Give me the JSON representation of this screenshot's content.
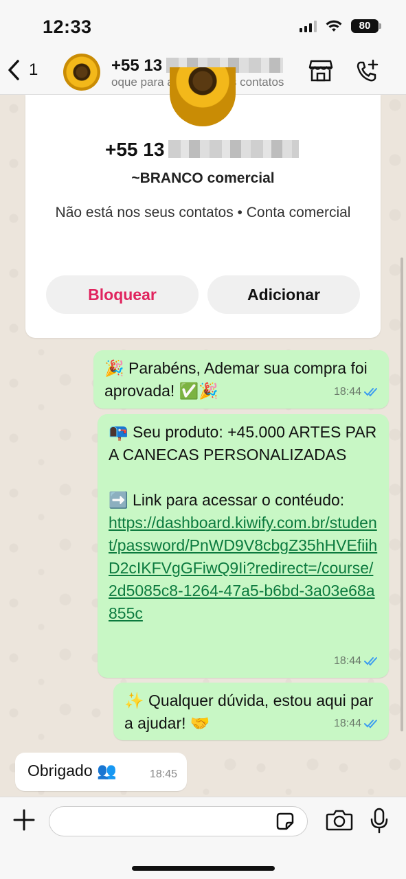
{
  "status_bar": {
    "time": "12:33",
    "battery": "80"
  },
  "header": {
    "back_count": "1",
    "contact_name": "+55 13",
    "contact_sub": "oque para adicionar aos contatos",
    "icons": [
      "back-chevron-icon",
      "store-icon",
      "add-call-icon"
    ]
  },
  "info_card": {
    "phone": "+55 13",
    "business_name": "~BRANCO comercial",
    "description": "Não está nos seus contatos • Conta comercial",
    "block_label": "Bloquear",
    "add_label": "Adicionar"
  },
  "messages": [
    {
      "direction": "out",
      "text": "🎉 Parabéns, Ademar sua compra foi aprovada! ✅🎉",
      "time": "18:44",
      "status": "read"
    },
    {
      "direction": "out",
      "text_a": "📭 Seu produto: +45.000 ARTES PARA CANECAS PERSONALIZADAS",
      "text_b": "➡️ Link para acessar o contéudo:",
      "link": "https://dashboard.kiwify.com.br/student/password/PnWD9V8cbgZ35hHVEfiihD2cIKFVgGFiwQ9Ii?redirect=/course/2d5085c8-1264-47a5-b6bd-3a03e68a855c",
      "time": "18:44",
      "status": "read"
    },
    {
      "direction": "out",
      "text": "✨ Qualquer dúvida, estou aqui para ajudar! 🤝",
      "time": "18:44",
      "status": "read"
    },
    {
      "direction": "in",
      "text": "Obrigado 👥",
      "time": "18:45"
    }
  ],
  "input_bar": {
    "placeholder": "",
    "icons": [
      "plus-icon",
      "sticker-icon",
      "camera-icon",
      "microphone-icon"
    ]
  },
  "colors": {
    "outgoing_bubble": "#c8f7c5",
    "incoming_bubble": "#ffffff",
    "block_red": "#e0245e",
    "link_green": "#0b7a3e",
    "read_ticks": "#3b9cf0"
  }
}
